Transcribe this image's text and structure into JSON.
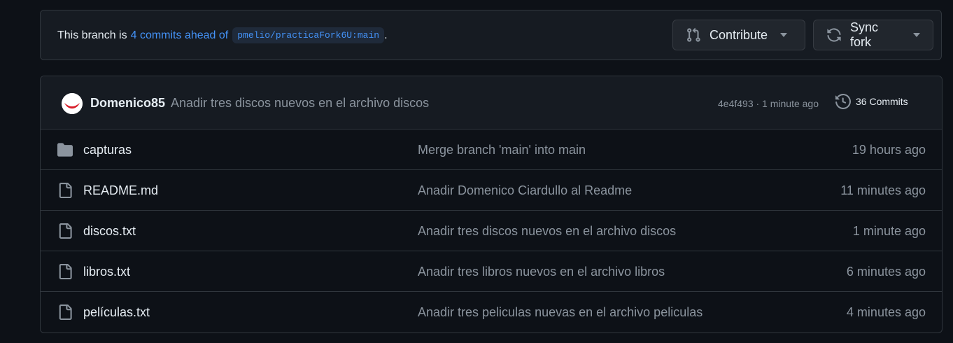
{
  "banner": {
    "prefix": "This branch is",
    "ahead_link": "4 commits ahead of",
    "ref": "pmelio/practicaFork6U:main",
    "suffix": "."
  },
  "buttons": {
    "contribute": {
      "label": "Contribute",
      "icon": "git-pull-request-icon"
    },
    "sync_fork": {
      "label": "Sync fork",
      "icon": "sync-icon"
    }
  },
  "latest_commit": {
    "author": "Domenico85",
    "message": "Anadir tres discos nuevos en el archivo discos",
    "hash_time": "4e4f493 · 1 minute ago",
    "commits_count": "36 Commits"
  },
  "files": [
    {
      "name": "capturas",
      "type": "folder",
      "message": "Merge branch 'main' into main",
      "time": "19 hours ago"
    },
    {
      "name": "README.md",
      "type": "file",
      "message": "Anadir Domenico Ciardullo al Readme",
      "time": "11 minutes ago"
    },
    {
      "name": "discos.txt",
      "type": "file",
      "message": "Anadir tres discos nuevos en el archivo discos",
      "time": "1 minute ago"
    },
    {
      "name": "libros.txt",
      "type": "file",
      "message": "Anadir tres libros nuevos en el archivo libros",
      "time": "6 minutes ago"
    },
    {
      "name": "películas.txt",
      "type": "file",
      "message": "Anadir tres peliculas nuevas en el archivo peliculas",
      "time": "4 minutes ago"
    }
  ],
  "colors": {
    "background": "#0d1117",
    "panel": "#161b22",
    "border": "#30363d",
    "link": "#4493f8",
    "muted": "#8b949e",
    "text": "#e6edf3"
  }
}
